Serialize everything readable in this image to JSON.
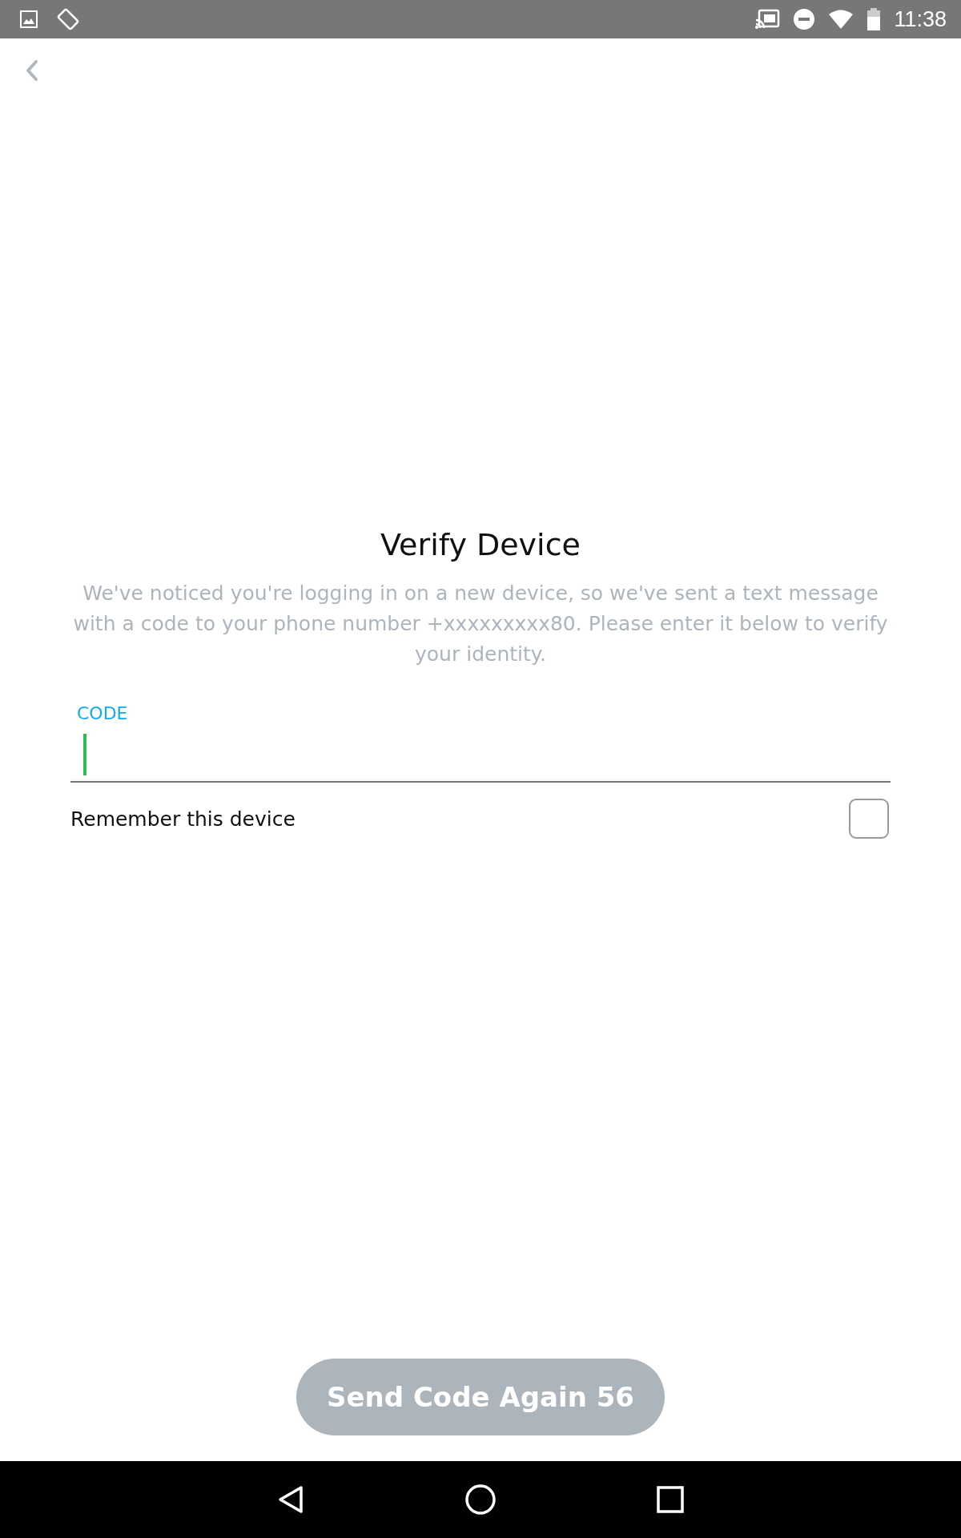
{
  "status_bar": {
    "time": "11:38"
  },
  "title": "Verify Device",
  "message": "We've noticed you're logging in on a new device, so we've sent a text message with a code to your phone number +xxxxxxxxx80. Please enter it below to verify your identity.",
  "code_field": {
    "label": "CODE",
    "focused": true
  },
  "remember": {
    "label": "Remember this device",
    "checked": false
  },
  "resend_button": {
    "label": "Send Code Again 56",
    "disabled": true
  }
}
